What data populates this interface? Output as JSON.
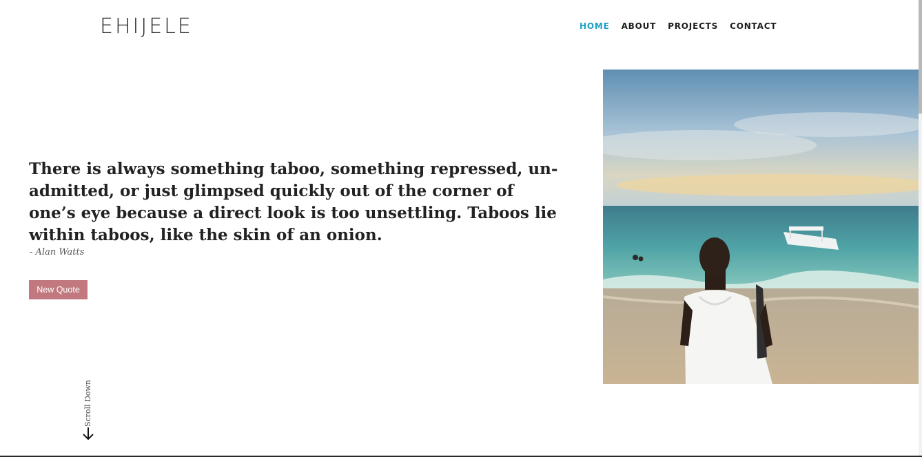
{
  "header": {
    "logo": "EHIJELE",
    "nav": [
      {
        "label": "HOME",
        "active": true
      },
      {
        "label": "ABOUT",
        "active": false
      },
      {
        "label": "PROJECTS",
        "active": false
      },
      {
        "label": "CONTACT",
        "active": false
      }
    ]
  },
  "hero": {
    "quote": "There is always something taboo, something repressed, un-admitted, or just glimpsed quickly out of the corner of one’s eye because a direct look is too unsettling. Taboos lie within taboos, like the skin of an onion.",
    "author": "- Alan Watts",
    "new_quote_label": "New Quote",
    "scroll_label": "Scroll Down"
  },
  "colors": {
    "accent": "#1aa1c4",
    "button": "#c1787f",
    "text": "#222222"
  },
  "icons": {
    "scroll": "arrow-down-icon"
  }
}
